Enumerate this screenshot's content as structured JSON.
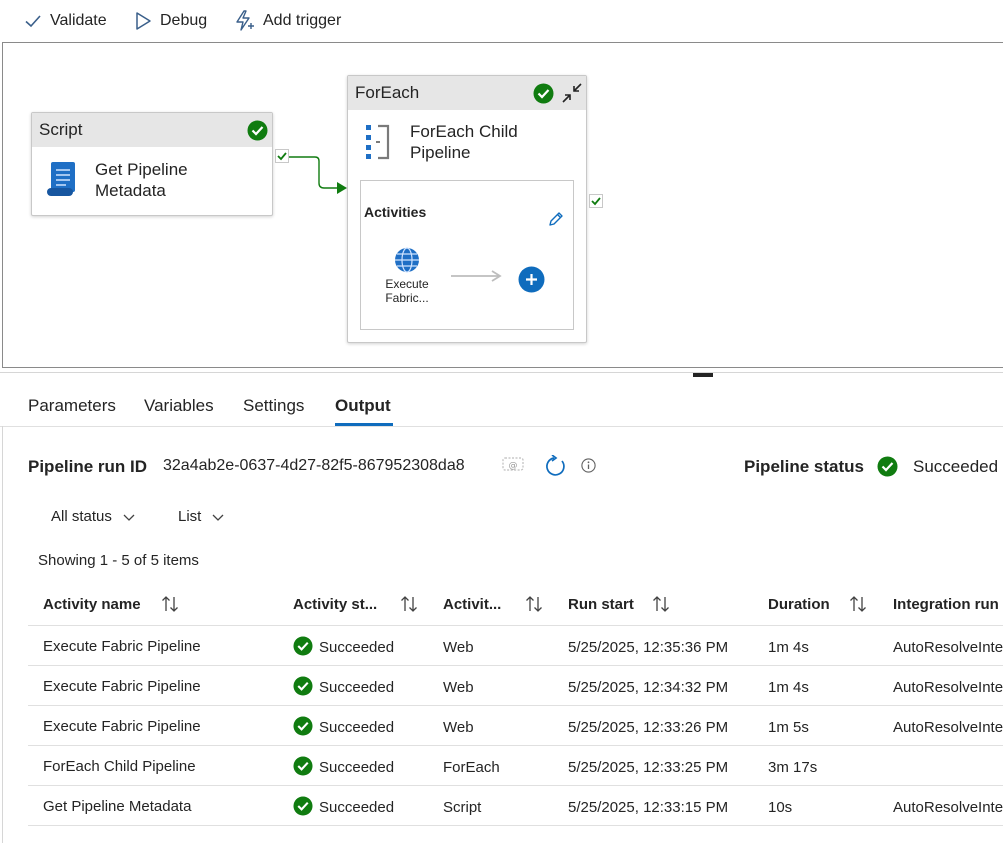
{
  "toolbar": {
    "validate": "Validate",
    "debug": "Debug",
    "add_trigger": "Add trigger"
  },
  "canvas": {
    "script_node": {
      "type_label": "Script",
      "name_line1": "Get Pipeline",
      "name_line2": "Metadata"
    },
    "foreach_node": {
      "type_label": "ForEach",
      "name_line1": "ForEach Child",
      "name_line2": "Pipeline",
      "activities_label": "Activities",
      "child_activity_line1": "Execute",
      "child_activity_line2": "Fabric..."
    }
  },
  "tabs": [
    {
      "label": "Parameters"
    },
    {
      "label": "Variables"
    },
    {
      "label": "Settings"
    },
    {
      "label": "Output",
      "active": true
    }
  ],
  "output": {
    "run_id_label": "Pipeline run ID",
    "run_id": "32a4ab2e-0637-4d27-82f5-867952308da8",
    "status_label": "Pipeline status",
    "status": "Succeeded",
    "filter_status": "All status",
    "view_mode": "List",
    "showing": "Showing 1 - 5 of 5 items",
    "columns": [
      "Activity name",
      "Activity st...",
      "Activit...",
      "Run start",
      "Duration",
      "Integration run"
    ],
    "rows": [
      {
        "name": "Execute Fabric Pipeline",
        "status": "Succeeded",
        "type": "Web",
        "start": "5/25/2025, 12:35:36 PM",
        "duration": "1m 4s",
        "ir": "AutoResolveInte"
      },
      {
        "name": "Execute Fabric Pipeline",
        "status": "Succeeded",
        "type": "Web",
        "start": "5/25/2025, 12:34:32 PM",
        "duration": "1m 4s",
        "ir": "AutoResolveInte"
      },
      {
        "name": "Execute Fabric Pipeline",
        "status": "Succeeded",
        "type": "Web",
        "start": "5/25/2025, 12:33:26 PM",
        "duration": "1m 5s",
        "ir": "AutoResolveInte"
      },
      {
        "name": "ForEach Child Pipeline",
        "status": "Succeeded",
        "type": "ForEach",
        "start": "5/25/2025, 12:33:25 PM",
        "duration": "3m 17s",
        "ir": ""
      },
      {
        "name": "Get Pipeline Metadata",
        "status": "Succeeded",
        "type": "Script",
        "start": "5/25/2025, 12:33:15 PM",
        "duration": "10s",
        "ir": "AutoResolveInte"
      }
    ]
  },
  "colors": {
    "success": "#107c10",
    "accent": "#0f6cbd",
    "header_grey": "#e6e6e6"
  },
  "icons": [
    "check-icon",
    "play-outline-icon",
    "lightning-add-icon",
    "script-scroll-icon",
    "foreach-icon",
    "collapse-icon",
    "edit-pencil-icon",
    "globe-icon",
    "add-circle-icon",
    "copy-icon",
    "refresh-icon",
    "info-icon",
    "chevron-down-icon",
    "sort-icon",
    "success-check-icon"
  ]
}
